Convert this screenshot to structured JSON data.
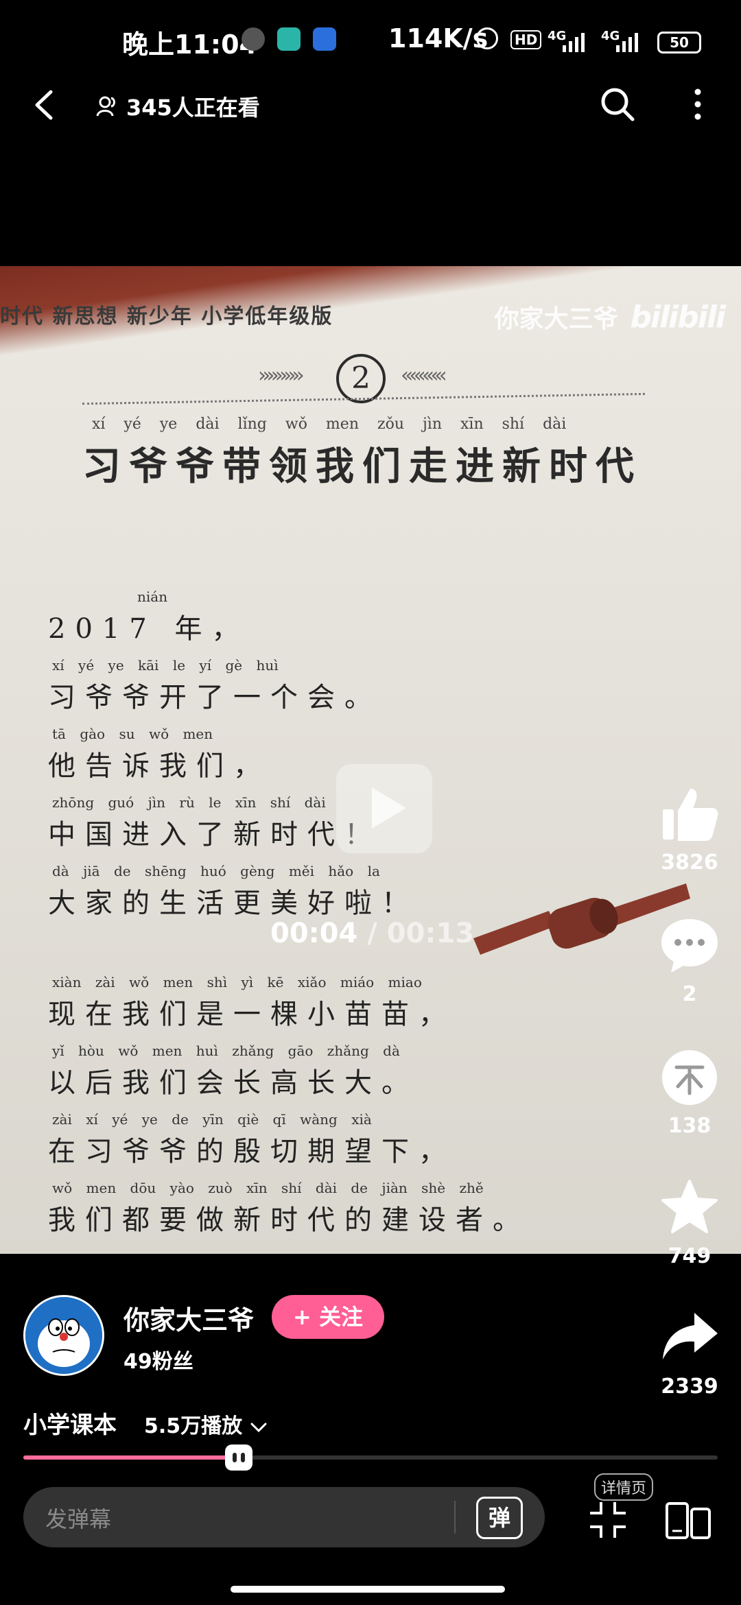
{
  "status_bar": {
    "time": "晚上11:04",
    "network_speed": "114K/s",
    "hd_label": "HD",
    "signal_label_1": "4G",
    "signal_label_2": "4G",
    "battery": "50"
  },
  "top_nav": {
    "viewers": "345人正在看"
  },
  "video": {
    "book_series": "时代   新思想   新少年   小学低年级版",
    "watermark_name": "你家大三爷",
    "watermark_brand": "bilibili",
    "lesson_number": "2",
    "chev_left": "»»»»»",
    "chev_right": "«««««",
    "title_pinyin": "xí yé ye dài lǐng wǒ men zǒu jìn xīn shí dài",
    "title_hanzi": "习爷爷带领我们走进新时代",
    "stanza1": [
      {
        "py": "nián",
        "hz": "2017 年，"
      },
      {
        "py": "xí yé ye kāi le yí gè huì",
        "hz": "习爷爷开了一个会。"
      },
      {
        "py": "tā gào su wǒ men",
        "hz": "他告诉我们，"
      },
      {
        "py": "zhōng guó jìn rù le xīn shí dài",
        "hz": "中国进入了新时代！"
      },
      {
        "py": "dà jiā de shēng huó gèng měi hǎo la",
        "hz": "大家的生活更美好啦！"
      }
    ],
    "stanza2": [
      {
        "py": "xiàn zài wǒ men shì yì kē xiǎo miáo miao",
        "hz": "现在我们是一棵小苗苗，"
      },
      {
        "py": "yǐ hòu wǒ men huì zhǎng gāo zhǎng dà",
        "hz": "以后我们会长高长大。"
      },
      {
        "py": "zài xí yé ye de yīn qiè qī wàng xià",
        "hz": "在习爷爷的殷切期望下，"
      },
      {
        "py": "wǒ men dōu yào zuò xīn shí dài de jiàn shè zhě",
        "hz": "我们都要做新时代的建设者。"
      }
    ],
    "time_current": "00:04",
    "time_separator": " / ",
    "time_total": "00:13"
  },
  "actions": {
    "like_count": "3826",
    "comment_count": "2",
    "coin_count": "138",
    "favorite_count": "749",
    "share_count": "2339"
  },
  "author": {
    "name": "你家大三爷",
    "follow_label": "+ 关注",
    "fans": "49粉丝"
  },
  "collection": {
    "name": "小学课本",
    "plays": "5.5万播放"
  },
  "progress": {
    "fraction": 0.31
  },
  "bottom_bar": {
    "danmu_placeholder": "发弹幕",
    "danmu_toggle": "弹",
    "detail_label": "详情页"
  }
}
